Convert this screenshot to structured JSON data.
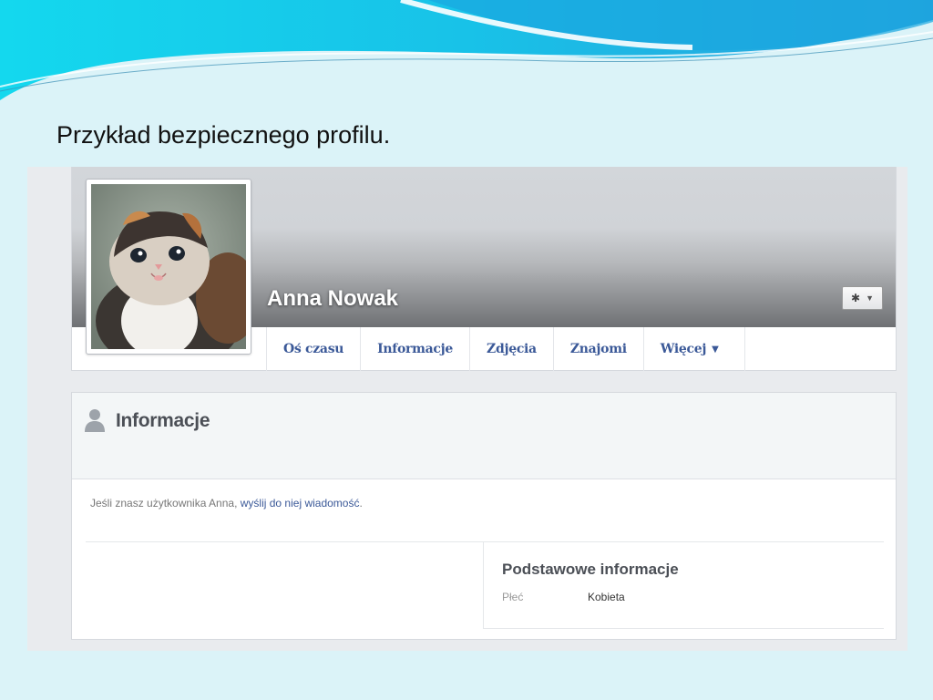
{
  "slide": {
    "title": "Przykład bezpiecznego profilu."
  },
  "profile": {
    "name": "Anna Nowak",
    "photo": "kitten-photo",
    "settings_icon": "gear-icon",
    "tabs": [
      {
        "label": "Oś czasu"
      },
      {
        "label": "Informacje"
      },
      {
        "label": "Zdjęcia"
      },
      {
        "label": "Znajomi"
      },
      {
        "label": "Więcej",
        "dropdown": true
      }
    ]
  },
  "info_section": {
    "icon": "person-icon",
    "title": "Informacje",
    "message_prefix": "Jeśli znasz użytkownika Anna, ",
    "message_link": "wyślij do niej wiadomość",
    "message_suffix": ".",
    "basic": {
      "title": "Podstawowe informacje",
      "field_label": "Płeć",
      "field_value": "Kobieta"
    }
  },
  "colors": {
    "link": "#3b5998",
    "slide_background": "#dbf3f8",
    "wave_cyan": "#11c8e6"
  }
}
